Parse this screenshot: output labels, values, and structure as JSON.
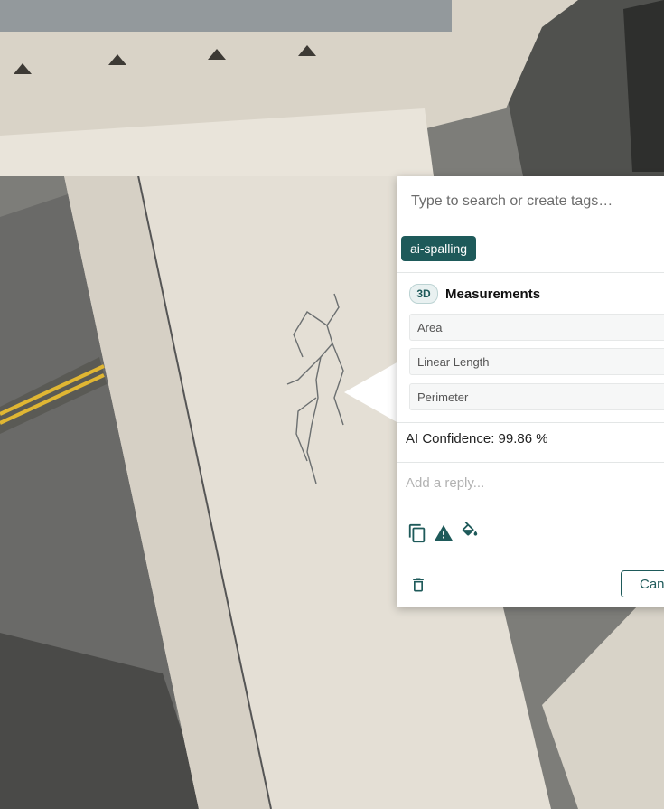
{
  "tag_search": {
    "placeholder": "Type to search or create tags…"
  },
  "tags": [
    {
      "label": "ai-spalling"
    }
  ],
  "measurements": {
    "badge": "3D",
    "title": "Measurements",
    "rows": [
      {
        "label": "Area"
      },
      {
        "label": "Linear Length"
      },
      {
        "label": "Perimeter"
      }
    ]
  },
  "confidence_text": "AI Confidence: 99.86 %",
  "reply": {
    "placeholder": "Add a reply..."
  },
  "toolbar_icons": [
    "copy-icon",
    "warning-icon",
    "paint-bucket-icon"
  ],
  "footer": {
    "delete_icon": "trash-icon",
    "cancel_label": "Can"
  },
  "colors": {
    "accent": "#1e5a5a",
    "panel_bg": "#ffffff"
  }
}
